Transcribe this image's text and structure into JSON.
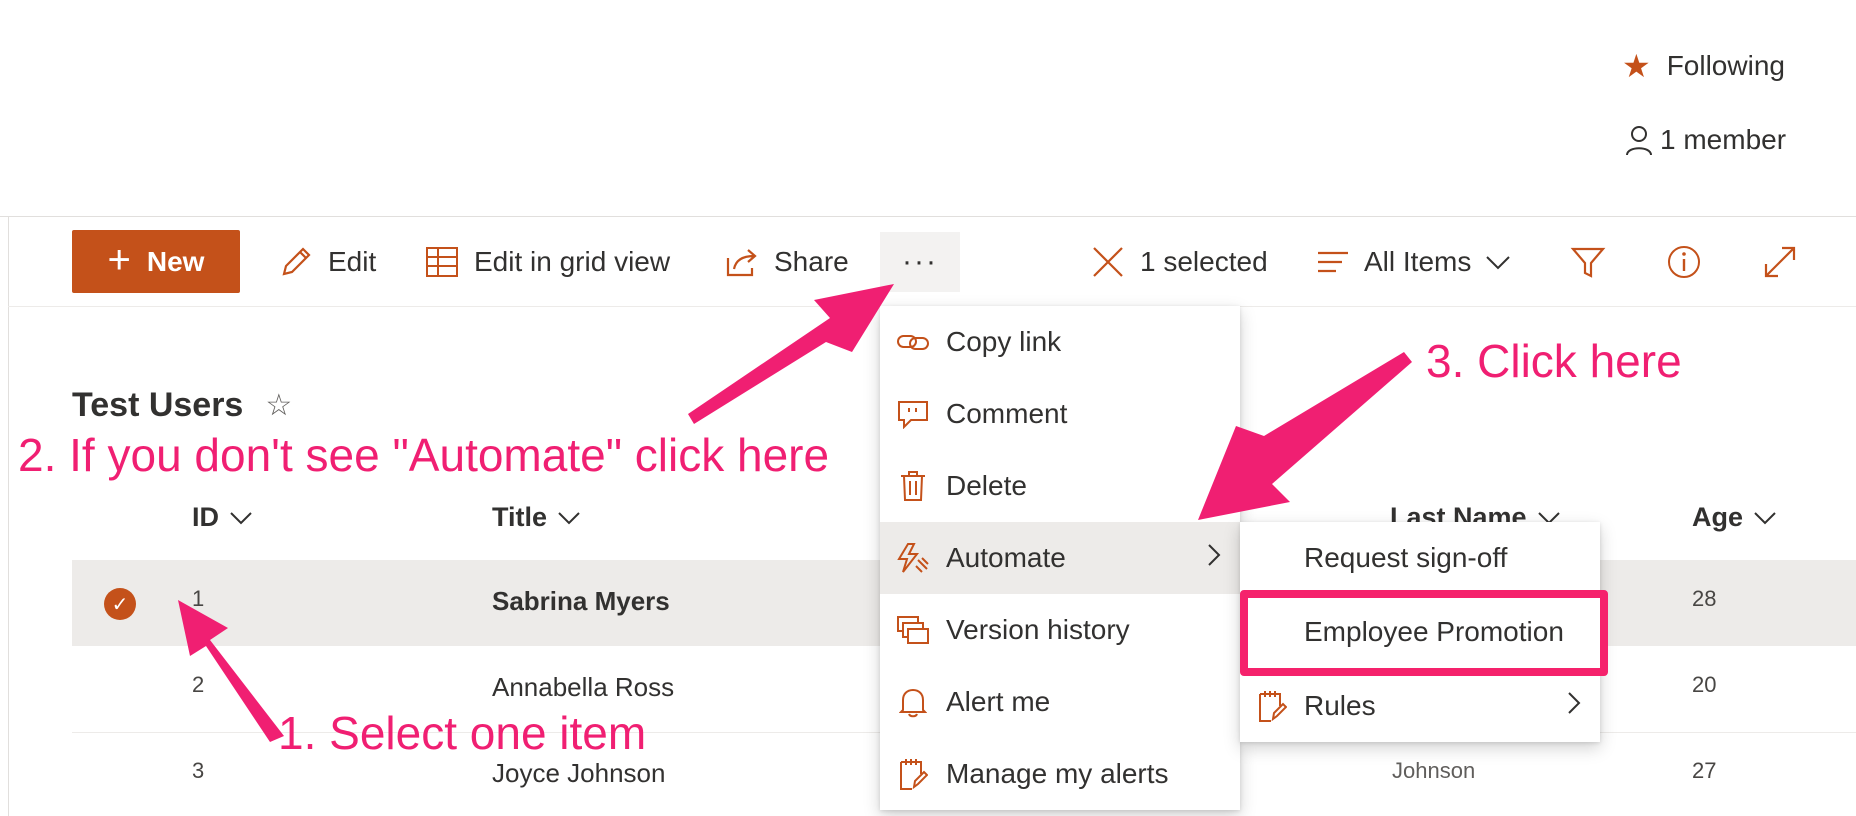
{
  "header": {
    "following_label": "Following",
    "member_label": "1 member"
  },
  "toolbar": {
    "new_label": "New",
    "edit_label": "Edit",
    "grid_label": "Edit in grid view",
    "share_label": "Share",
    "more_label": "···",
    "selected_label": "1 selected",
    "view_label": "All Items"
  },
  "list": {
    "title": "Test Users",
    "columns": {
      "id": "ID",
      "title": "Title",
      "last_name": "Last Name",
      "age": "Age"
    },
    "rows": [
      {
        "id": "1",
        "title": "Sabrina Myers",
        "last_name": "",
        "age": "28",
        "selected": true
      },
      {
        "id": "2",
        "title": "Annabella Ross",
        "last_name": "",
        "age": "20",
        "selected": false
      },
      {
        "id": "3",
        "title": "Joyce Johnson",
        "last_name": "Johnson",
        "age": "27",
        "selected": false
      }
    ]
  },
  "context_menu": {
    "items": [
      {
        "label": "Copy link",
        "icon": "link-icon"
      },
      {
        "label": "Comment",
        "icon": "comment-icon"
      },
      {
        "label": "Delete",
        "icon": "delete-icon"
      },
      {
        "label": "Automate",
        "icon": "automate-icon"
      },
      {
        "label": "Version history",
        "icon": "version-history-icon"
      },
      {
        "label": "Alert me",
        "icon": "bell-icon"
      },
      {
        "label": "Manage my alerts",
        "icon": "manage-alerts-icon"
      }
    ]
  },
  "submenu": {
    "items": [
      {
        "label": "Request sign-off"
      },
      {
        "label": "Employee Promotion"
      },
      {
        "label": "Rules",
        "icon": "rules-icon"
      }
    ]
  },
  "annotations": {
    "step1": "1. Select one item",
    "step2": "2. If you don't see \"Automate\" click here",
    "step3": "3. Click here"
  },
  "colors": {
    "accent": "#c4511a",
    "annotation": "#f01f72",
    "selected_row": "#edebe9"
  }
}
